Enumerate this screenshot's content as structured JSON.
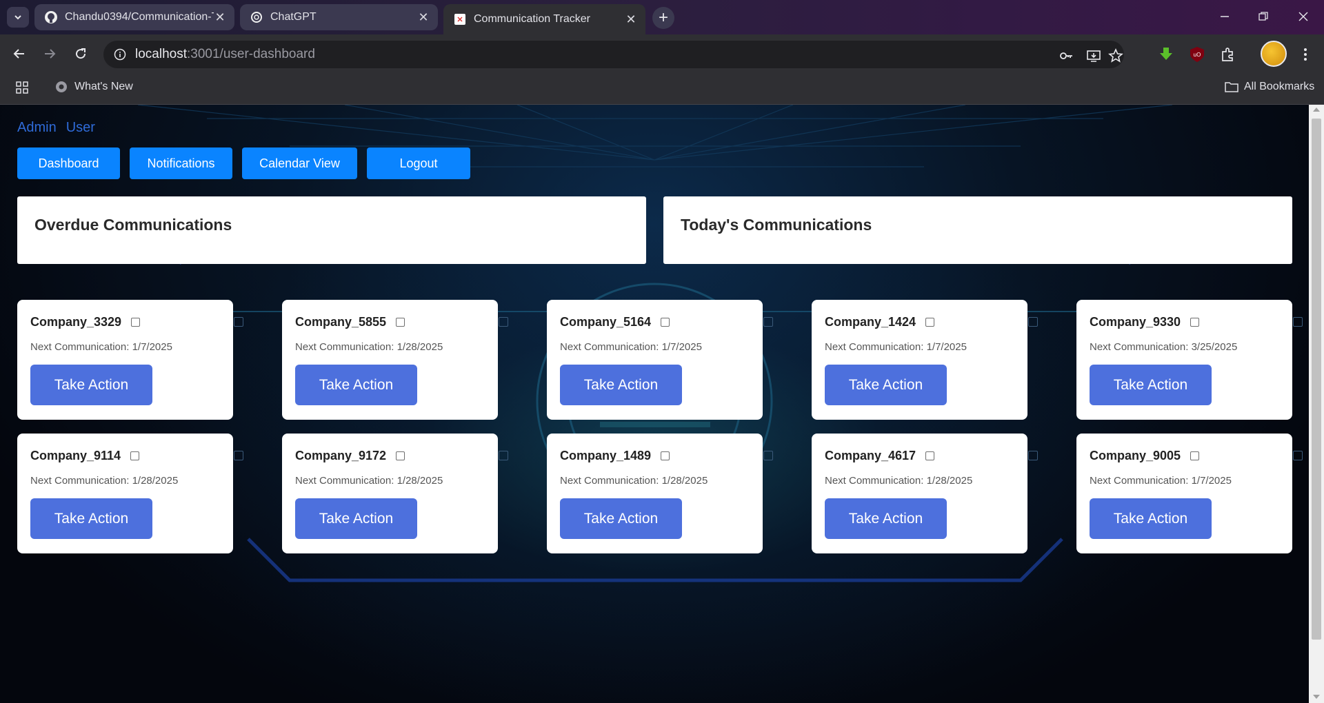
{
  "browser": {
    "tabs": [
      {
        "title": "Chandu0394/Communication-T",
        "icon": "github-icon"
      },
      {
        "title": "ChatGPT",
        "icon": "chatgpt-icon"
      },
      {
        "title": "Communication Tracker",
        "icon": "tracker-favicon",
        "active": true
      }
    ],
    "url_host": "localhost",
    "url_path": ":3001/user-dashboard",
    "bookmarks": {
      "whats_new": "What's New",
      "all_bookmarks": "All Bookmarks"
    }
  },
  "roles": {
    "admin": "Admin",
    "user": "User"
  },
  "nav": {
    "dashboard": "Dashboard",
    "notifications": "Notifications",
    "calendar": "Calendar View",
    "logout": "Logout"
  },
  "panels": {
    "overdue": "Overdue Communications",
    "today": "Today's Communications"
  },
  "next_label": "Next Communication: ",
  "action_label": "Take Action",
  "companies": [
    {
      "name": "Company_3329",
      "next": "1/7/2025"
    },
    {
      "name": "Company_5855",
      "next": "1/28/2025"
    },
    {
      "name": "Company_5164",
      "next": "1/7/2025"
    },
    {
      "name": "Company_1424",
      "next": "1/7/2025"
    },
    {
      "name": "Company_9330",
      "next": "3/25/2025"
    },
    {
      "name": "Company_9114",
      "next": "1/28/2025"
    },
    {
      "name": "Company_9172",
      "next": "1/28/2025"
    },
    {
      "name": "Company_1489",
      "next": "1/28/2025"
    },
    {
      "name": "Company_4617",
      "next": "1/28/2025"
    },
    {
      "name": "Company_9005",
      "next": "1/7/2025"
    }
  ],
  "colors": {
    "primary_button": "#0a84ff",
    "action_button": "#4d70dd",
    "role_link": "#2f6bd8"
  }
}
